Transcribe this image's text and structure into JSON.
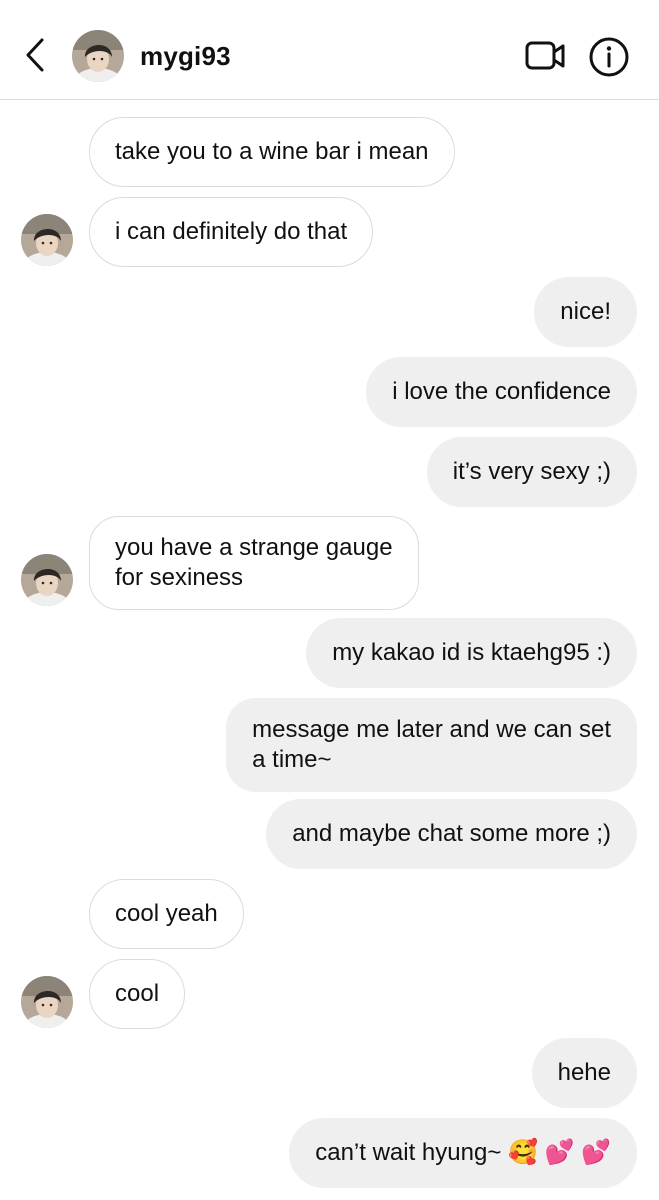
{
  "header": {
    "username": "mygi93",
    "back_icon": "chevron-left-icon",
    "video_icon": "video-camera-icon",
    "info_icon": "info-icon"
  },
  "colors": {
    "incoming_bubble_border": "#dbdbdb",
    "outgoing_bubble_bg": "#efefef",
    "text": "#111111"
  },
  "messages": [
    {
      "sender": "them",
      "text": "take you to a wine bar i mean"
    },
    {
      "sender": "them",
      "text": "i can definitely do that"
    },
    {
      "sender": "me",
      "text": "nice!"
    },
    {
      "sender": "me",
      "text": "i love the confidence"
    },
    {
      "sender": "me",
      "text": "it’s very sexy ;)"
    },
    {
      "sender": "them",
      "lines": [
        "you have a strange gauge",
        "for sexiness"
      ]
    },
    {
      "sender": "me",
      "text": "my kakao id is ktaehg95 :)"
    },
    {
      "sender": "me",
      "lines": [
        "message me later and we can set",
        "a time~"
      ]
    },
    {
      "sender": "me",
      "text": "and maybe chat some more ;)"
    },
    {
      "sender": "them",
      "text": "cool yeah"
    },
    {
      "sender": "them",
      "text": "cool"
    },
    {
      "sender": "me",
      "text": "hehe"
    },
    {
      "sender": "me",
      "text": "can’t wait hyung~ 🥰 💕 💕"
    }
  ]
}
